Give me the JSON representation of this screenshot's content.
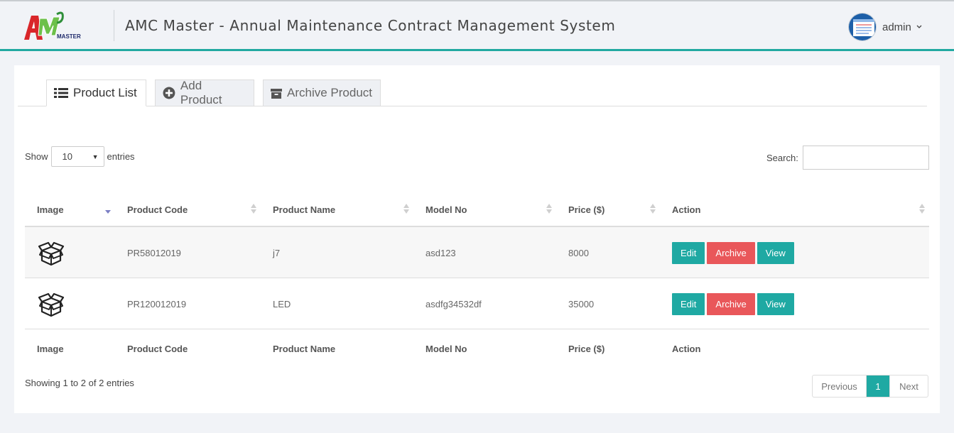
{
  "header": {
    "logo_text": "MASTER",
    "title": "AMC Master - Annual Maintenance Contract Management System",
    "user": "admin",
    "accent_color": "#21a9a1"
  },
  "tabs": [
    {
      "label": "Product List",
      "icon": "list-icon",
      "active": true
    },
    {
      "label": "Add Product",
      "icon": "plus-circle-icon",
      "active": false
    },
    {
      "label": "Archive Product",
      "icon": "archive-icon",
      "active": false
    }
  ],
  "controls": {
    "show_label": "Show",
    "page_length": "10",
    "entries_label": "entries",
    "search_label": "Search:",
    "search_value": ""
  },
  "table": {
    "columns": [
      "Image",
      "Product Code",
      "Product Name",
      "Model No",
      "Price ($)",
      "Action"
    ],
    "rows": [
      {
        "image": "box-icon",
        "code": "PR58012019",
        "name": "j7",
        "model": "asd123",
        "price": "8000"
      },
      {
        "image": "box-icon",
        "code": "PR120012019",
        "name": "LED",
        "model": "asdfg34532df",
        "price": "35000"
      }
    ],
    "actions": {
      "edit": "Edit",
      "archive": "Archive",
      "view": "View"
    }
  },
  "footer": {
    "info": "Showing 1 to 2 of 2 entries",
    "previous": "Previous",
    "current_page": "1",
    "next": "Next"
  }
}
